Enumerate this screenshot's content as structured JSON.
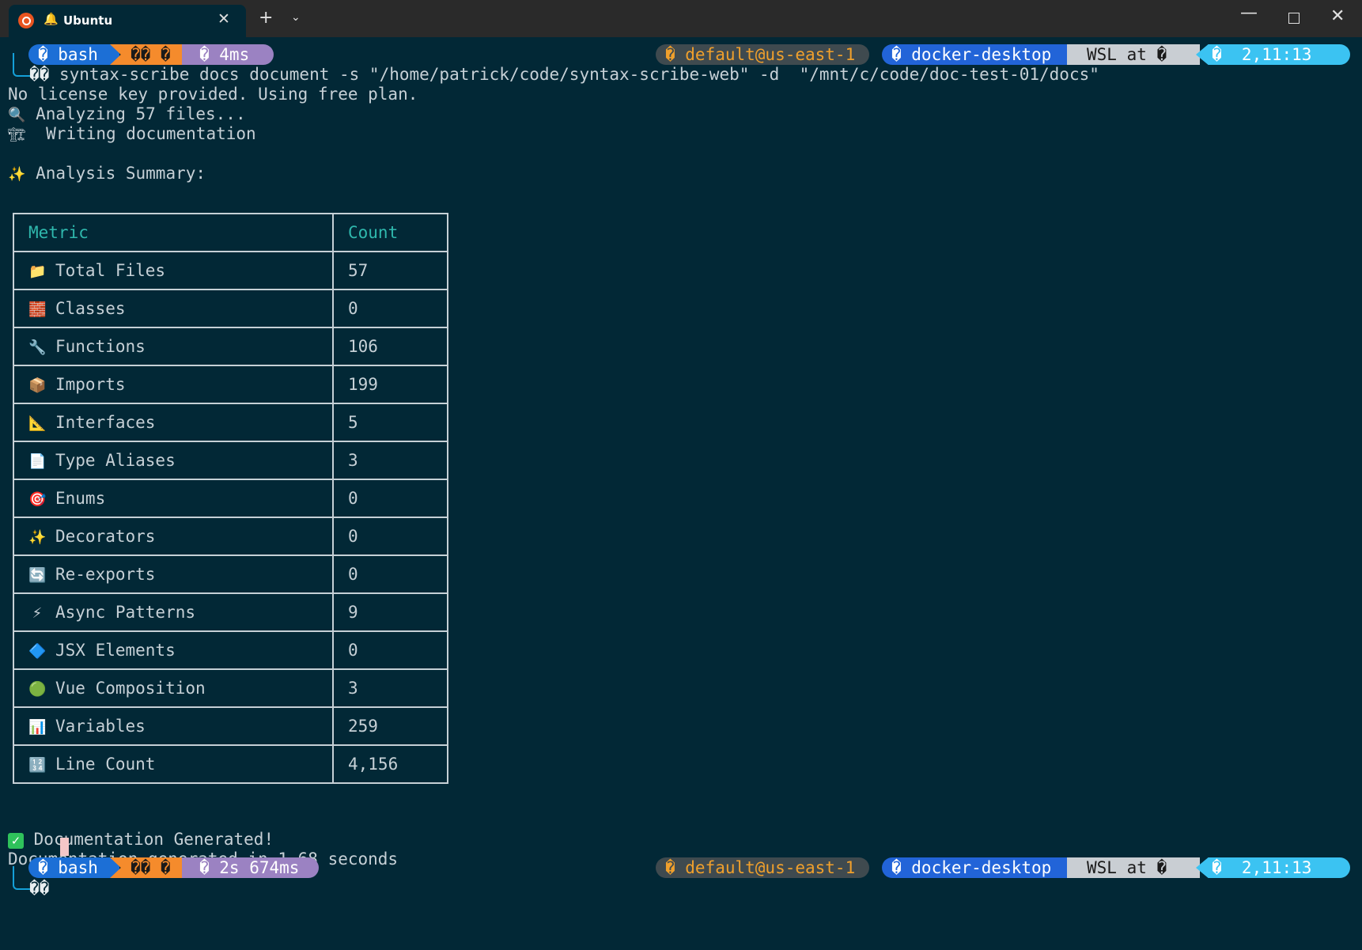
{
  "window": {
    "tab_title": "Ubuntu",
    "icons": [
      "ubuntu-logo",
      "bell-icon",
      "close-icon",
      "plus-icon",
      "chevron-down-icon",
      "minimize-icon",
      "maximize-icon",
      "close-window-icon"
    ]
  },
  "prompt_top": {
    "shell": "� bash",
    "git": "�� �",
    "duration": "� 4ms",
    "aws": "� default@us-east-1",
    "kube": "� docker-desktop",
    "os": "WSL at �",
    "time": "�  2,11:13",
    "char": "��"
  },
  "command": "syntax-scribe docs document -s \"/home/patrick/code/syntax-scribe-web\" -d  \"/mnt/c/code/doc-test-01/docs\"",
  "output": {
    "license": "No license key provided. Using free plan.",
    "analyzing": "Analyzing 57 files...",
    "writing": "Writing documentation",
    "summary_heading": "Analysis Summary:",
    "done": "Documentation Generated!",
    "timing": "Documentation generated in 1.68 seconds"
  },
  "table": {
    "headers": [
      "Metric",
      "Count"
    ],
    "rows": [
      {
        "icon": "folder-icon",
        "glyph": "📁",
        "metric": "Total Files",
        "count": "57"
      },
      {
        "icon": "bricks-icon",
        "glyph": "🧱",
        "metric": "Classes",
        "count": "0"
      },
      {
        "icon": "wrench-icon",
        "glyph": "🔧",
        "metric": "Functions",
        "count": "106"
      },
      {
        "icon": "package-icon",
        "glyph": "📦",
        "metric": "Imports",
        "count": "199"
      },
      {
        "icon": "triangle-ruler-icon",
        "glyph": "📐",
        "metric": "Interfaces",
        "count": "5"
      },
      {
        "icon": "page-icon",
        "glyph": "📄",
        "metric": "Type Aliases",
        "count": "3"
      },
      {
        "icon": "target-icon",
        "glyph": "🎯",
        "metric": "Enums",
        "count": "0"
      },
      {
        "icon": "sparkles-icon",
        "glyph": "✨",
        "metric": "Decorators",
        "count": "0"
      },
      {
        "icon": "refresh-icon",
        "glyph": "🔄",
        "metric": "Re-exports",
        "count": "0"
      },
      {
        "icon": "lightning-icon",
        "glyph": "⚡",
        "metric": "Async Patterns",
        "count": "9"
      },
      {
        "icon": "blue-diamond-icon",
        "glyph": "🔷",
        "metric": "JSX Elements",
        "count": "0"
      },
      {
        "icon": "green-circle-icon",
        "glyph": "🟢",
        "metric": "Vue Composition",
        "count": "3"
      },
      {
        "icon": "bar-chart-icon",
        "glyph": "📊",
        "metric": "Variables",
        "count": "259"
      },
      {
        "icon": "numbers-icon",
        "glyph": "🔢",
        "metric": "Line Count",
        "count": "4,156"
      }
    ]
  },
  "prompt_bottom": {
    "shell": "� bash",
    "git": "�� �",
    "duration": "� 2s 674ms",
    "aws": "� default@us-east-1",
    "kube": "� docker-desktop",
    "os": "WSL at �",
    "time": "�  2,11:13",
    "char": "��"
  },
  "colors": {
    "background": "#022836",
    "shell_seg": "#1c6fd6",
    "git_seg": "#f58b2c",
    "duration_seg": "#9b82c2",
    "aws_seg": "#3f4a4f",
    "kube_seg": "#2264d8",
    "os_seg": "#c9ced3",
    "time_seg": "#3bc3f2"
  }
}
